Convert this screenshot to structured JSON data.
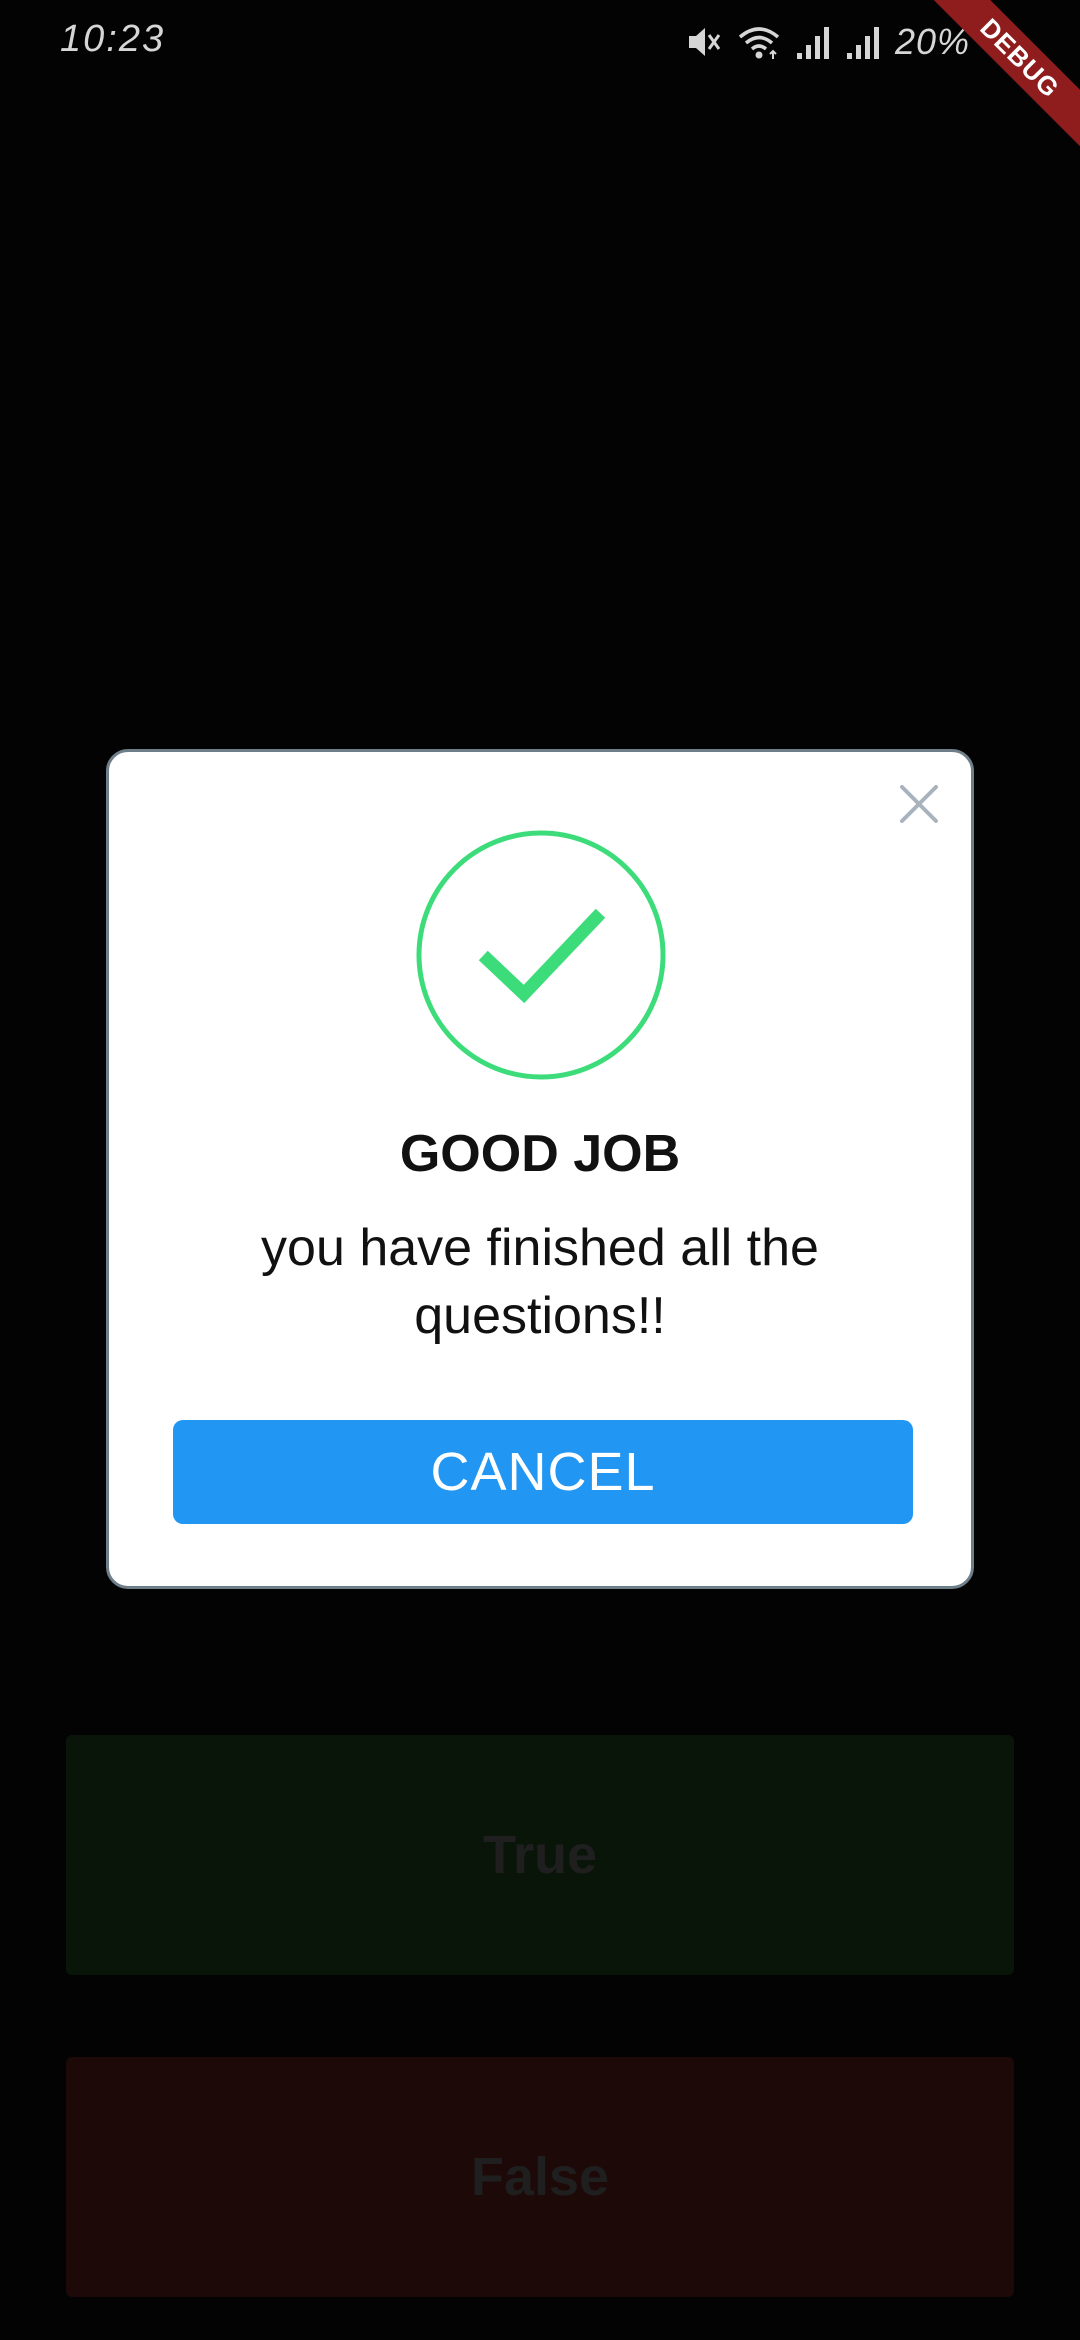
{
  "status_bar": {
    "time": "10:23",
    "battery": "20%",
    "icons": [
      "mute-icon",
      "wifi-icon",
      "signal-icon",
      "signal-icon",
      "battery-icon"
    ]
  },
  "debug_banner": {
    "label": "DEBUG"
  },
  "dialog": {
    "title": "GOOD JOB",
    "message": "you have finished all the questions!!",
    "cancel_label": "CANCEL",
    "close_icon": "close-icon",
    "success_icon": "check-circle-icon"
  },
  "answers": {
    "true_label": "True",
    "false_label": "False"
  },
  "colors": {
    "accent": "#2196f3",
    "success": "#3ddc7a",
    "debug": "#8f1d1d",
    "true_bg": "#0a150a",
    "false_bg": "#1e0909"
  }
}
